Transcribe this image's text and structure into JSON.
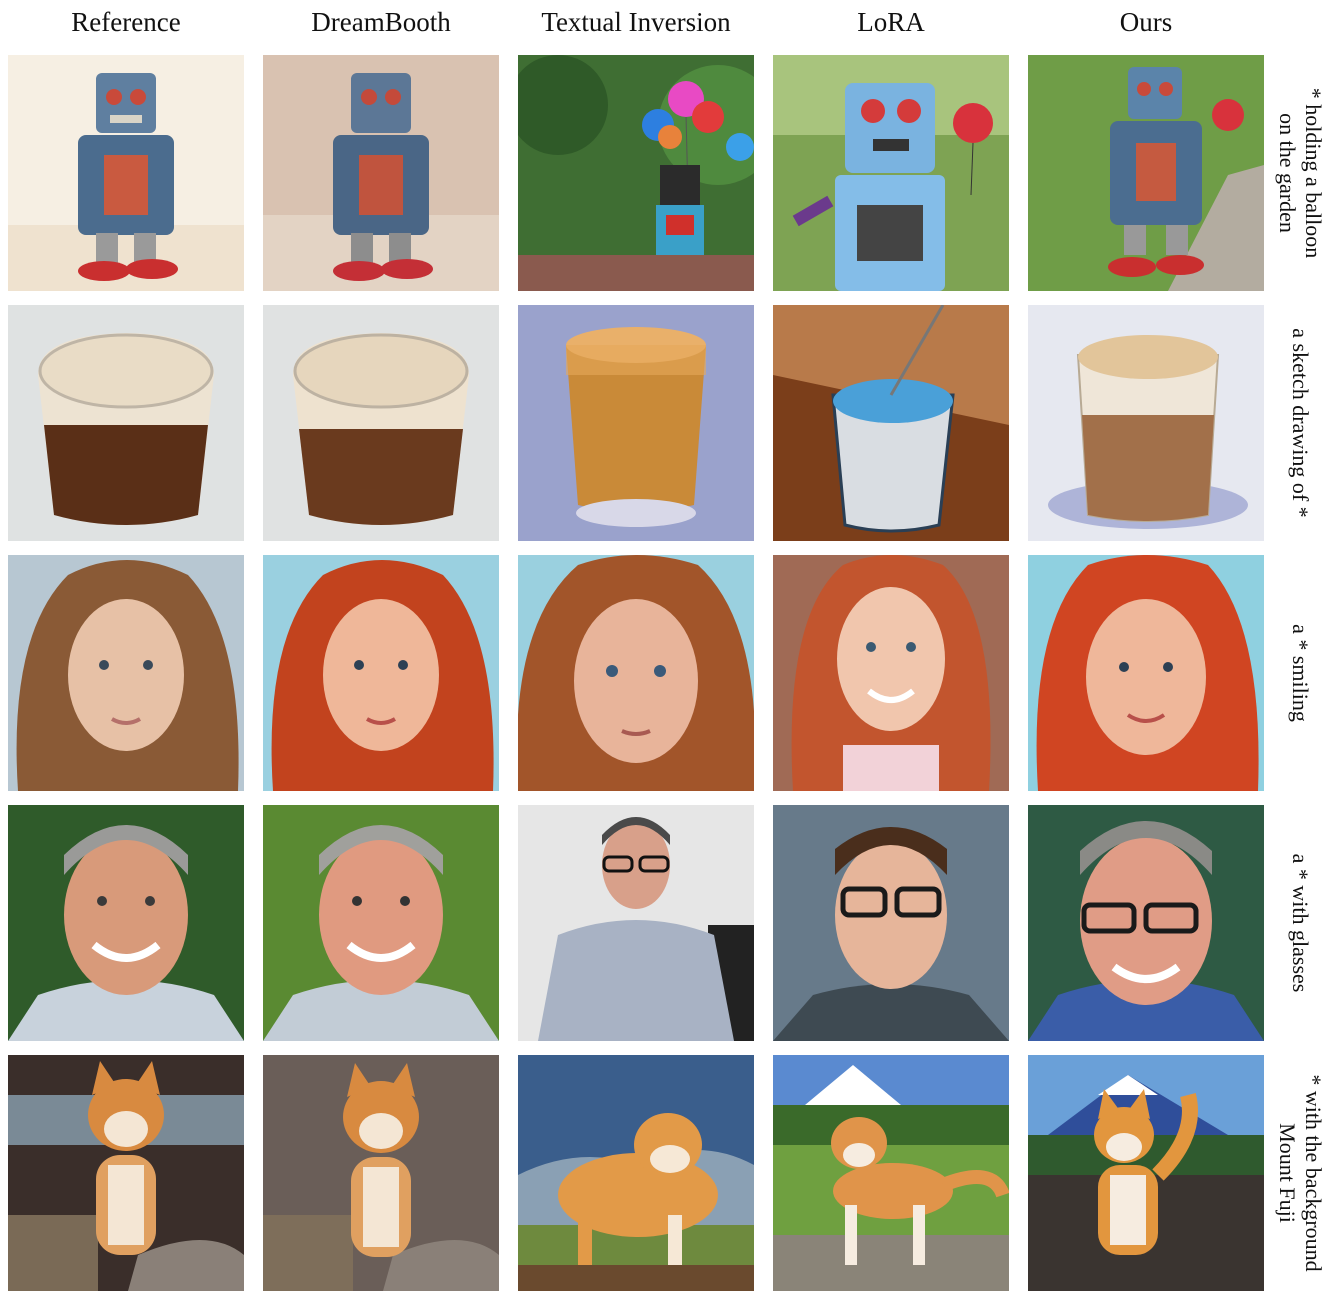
{
  "columns": [
    "Reference",
    "DreamBooth",
    "Textual Inversion",
    "LoRA",
    "Ours"
  ],
  "rows": [
    {
      "prompt": "* holding a balloon\non the garden",
      "subject": "robot"
    },
    {
      "prompt": "a sketch drawing of *",
      "subject": "glass"
    },
    {
      "prompt": "a * smiling",
      "subject": "woman"
    },
    {
      "prompt": "a * with glasses",
      "subject": "man"
    },
    {
      "prompt": "* with the background\nMount Fuji",
      "subject": "dog"
    }
  ]
}
